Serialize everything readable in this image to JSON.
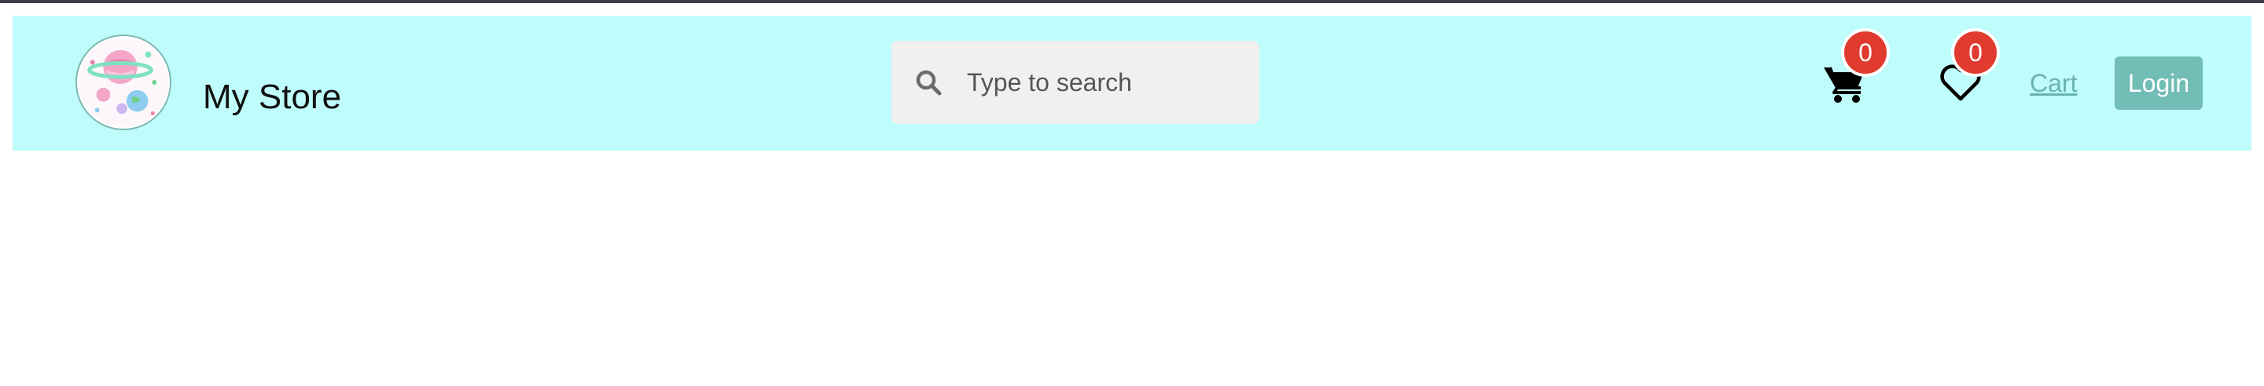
{
  "header": {
    "store_name": "My Store",
    "logo_icon": "planet-logo-icon"
  },
  "search": {
    "placeholder": "Type to search",
    "value": "",
    "icon": "search-icon"
  },
  "cart": {
    "icon": "shopping-cart-icon",
    "count": "0",
    "link_label": "Cart"
  },
  "wishlist": {
    "icon": "heart-icon",
    "count": "0"
  },
  "auth": {
    "login_label": "Login"
  },
  "colors": {
    "navbar_bg": "#bffcfc",
    "badge": "#e03b2e",
    "accent": "#72bdb6",
    "link": "#6ab4ad",
    "search_bg": "#f0f0f0"
  }
}
